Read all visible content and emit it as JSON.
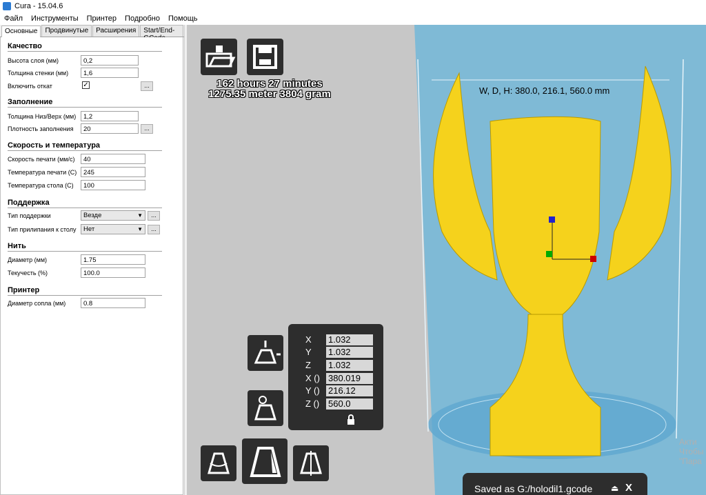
{
  "window": {
    "title": "Cura - 15.04.6"
  },
  "menu": [
    "Файл",
    "Инструменты",
    "Принтер",
    "Подробно",
    "Помощь"
  ],
  "tabs": [
    "Основные",
    "Продвинутые",
    "Расширения",
    "Start/End-GCode"
  ],
  "sections": {
    "quality": "Качество",
    "fill": "Заполнение",
    "speed": "Скорость и температура",
    "support": "Поддержка",
    "filament": "Нить",
    "printer": "Принтер"
  },
  "settings": {
    "layer_height": {
      "label": "Высота слоя (мм)",
      "value": "0,2"
    },
    "wall_thickness": {
      "label": "Толщина стенки (мм)",
      "value": "1,6"
    },
    "retraction": {
      "label": "Включить откат",
      "checked": "✓"
    },
    "bottom_top": {
      "label": "Толщина Низ/Верх (мм)",
      "value": "1,2"
    },
    "fill_density": {
      "label": "Плотность заполнения",
      "value": "20"
    },
    "print_speed": {
      "label": "Скорость печати (мм/с)",
      "value": "40"
    },
    "print_temp": {
      "label": "Температура печати (C)",
      "value": "245"
    },
    "bed_temp": {
      "label": "Температура стола (C)",
      "value": "100"
    },
    "support_type": {
      "label": "Тип поддержки",
      "value": "Везде"
    },
    "adhesion_type": {
      "label": "Тип прилипания к столу",
      "value": "Нет"
    },
    "diameter": {
      "label": "Диаметр (мм)",
      "value": "1.75"
    },
    "flow": {
      "label": "Текучесть (%)",
      "value": "100.0"
    },
    "nozzle": {
      "label": "Диаметр сопла (мм)",
      "value": "0.8"
    }
  },
  "dots_label": "...",
  "viewport": {
    "print_time": "162 hours 27 minutes",
    "print_usage": "1275.35 meter 3804 gram",
    "dimensions": "W, D, H: 380.0, 216.1, 560.0 mm"
  },
  "scale": {
    "x_label": "X",
    "y_label": "Y",
    "z_label": "Z",
    "x": "1.032",
    "y": "1.032",
    "z": "1.032",
    "sx_label": "X ()",
    "sy_label": "Y ()",
    "sz_label": "Z ()",
    "sx": "380.019",
    "sy": "216.12",
    "sz": "560.0"
  },
  "status": {
    "text": "Saved as G:/holodil1.gcode",
    "close": "X"
  },
  "watermark": [
    "Акти",
    "Чтобы",
    "\"Пара"
  ],
  "colors": {
    "viewport_bg": "#c7c7c7",
    "volume": "#7fbad6",
    "model": "#f5d21c",
    "toolbar": "#2d2d2d"
  }
}
